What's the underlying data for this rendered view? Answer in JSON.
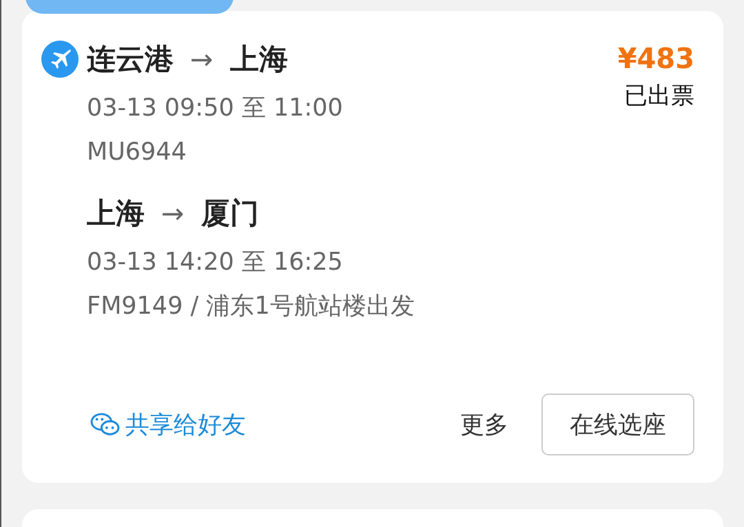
{
  "order": {
    "price": "¥483",
    "status": "已出票",
    "segments": [
      {
        "from": "连云港",
        "arrow": "→",
        "to": "上海",
        "time": "03-13 09:50 至 11:00",
        "detail": "MU6944",
        "icon": true
      },
      {
        "from": "上海",
        "arrow": "→",
        "to": "厦门",
        "time": "03-13 14:20 至 16:25",
        "detail": "FM9149 / 浦东1号航站楼出发",
        "icon": false
      }
    ],
    "share": "共享给好友",
    "more": "更多",
    "seat_button": "在线选座"
  }
}
